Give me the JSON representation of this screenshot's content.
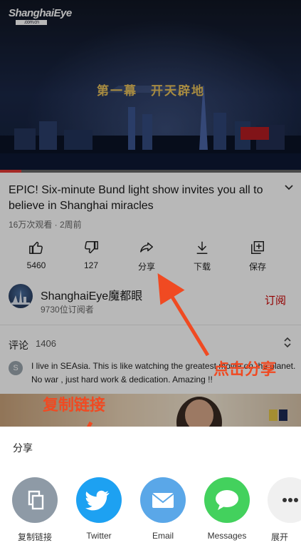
{
  "player": {
    "logo_text": "ShanghaiEye",
    "logo_sub": ".com.cn",
    "overlay_title": "第一幕　开天辟地",
    "progress_fraction": 0.07
  },
  "video": {
    "title": "EPIC! Six-minute Bund light show invites you all to believe in Shanghai miracles",
    "meta": "16万次观看 · 2周前"
  },
  "actions": [
    {
      "icon": "thumbs-up-icon",
      "label": "5460"
    },
    {
      "icon": "thumbs-down-icon",
      "label": "127"
    },
    {
      "icon": "share-icon",
      "label": "分享"
    },
    {
      "icon": "download-icon",
      "label": "下载"
    },
    {
      "icon": "save-icon",
      "label": "保存"
    }
  ],
  "channel": {
    "name": "ShanghaiEye魔都眼",
    "subscribers": "9730位订阅者",
    "subscribe_label": "订阅"
  },
  "comments": {
    "label": "评论",
    "count": "1406",
    "first_author_initial": "S",
    "first_comment": "I live in SEAsia. This is like watching the greatest movie on the planet. No war , just hard work & dedication. Amazing !!"
  },
  "annotations": {
    "click_share": "点击分享",
    "copy_link": "复制链接",
    "color": "#f04a22"
  },
  "share_sheet": {
    "title": "分享",
    "targets": [
      {
        "icon": "copy-icon",
        "label": "复制链接",
        "color": "#8e9aa6"
      },
      {
        "icon": "twitter-icon",
        "label": "Twitter",
        "color": "#1da1f2"
      },
      {
        "icon": "email-icon",
        "label": "Email",
        "color": "#5aa7e8"
      },
      {
        "icon": "messages-icon",
        "label": "Messages",
        "color": "#43d15d"
      },
      {
        "icon": "more-icon",
        "label": "展开",
        "color": "#f0f0f0"
      }
    ]
  }
}
